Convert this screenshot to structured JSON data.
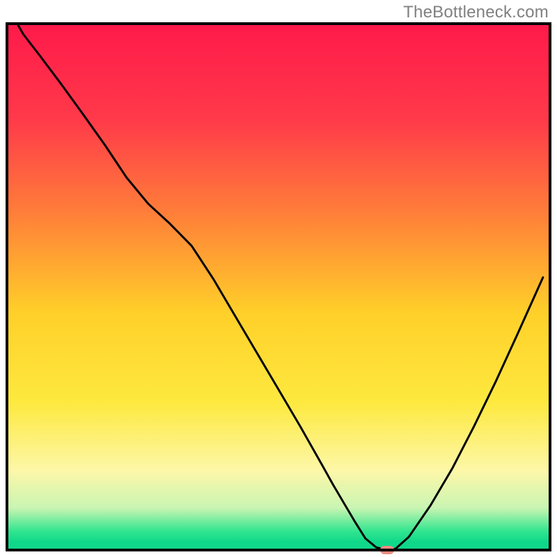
{
  "watermark": "TheBottleneck.com",
  "chart_data": {
    "type": "line",
    "title": "",
    "xlabel": "",
    "ylabel": "",
    "xlim": [
      0,
      100
    ],
    "ylim": [
      0,
      100
    ],
    "x": [
      1.9,
      3,
      6,
      10,
      14,
      18,
      22,
      26,
      30,
      34,
      38,
      42,
      46,
      50,
      54,
      58,
      60,
      62,
      64,
      66,
      68,
      70,
      71.5,
      74,
      78,
      82,
      86,
      90,
      94,
      98.7
    ],
    "values": [
      100,
      98,
      94,
      88.5,
      82.8,
      77,
      70.8,
      65.8,
      62,
      57.8,
      51.5,
      44.5,
      37.5,
      30.5,
      23.5,
      16.2,
      12.5,
      9,
      5.5,
      2.2,
      0.5,
      0,
      0.2,
      2.5,
      8.5,
      15.5,
      23.5,
      32,
      41,
      51.8
    ],
    "marker": {
      "x": 70,
      "y": 0
    },
    "gradient_stops": [
      {
        "pos": 0.0,
        "color": "#ff1a4a"
      },
      {
        "pos": 0.18,
        "color": "#ff394a"
      },
      {
        "pos": 0.35,
        "color": "#ff7a3a"
      },
      {
        "pos": 0.55,
        "color": "#ffd029"
      },
      {
        "pos": 0.72,
        "color": "#fde93f"
      },
      {
        "pos": 0.85,
        "color": "#fdf7a9"
      },
      {
        "pos": 0.92,
        "color": "#c9f5b2"
      },
      {
        "pos": 0.965,
        "color": "#2fe58f"
      },
      {
        "pos": 0.985,
        "color": "#10d88a"
      }
    ],
    "marker_color": "#f28b82",
    "curve_color": "#000000",
    "border_color": "#000000"
  }
}
